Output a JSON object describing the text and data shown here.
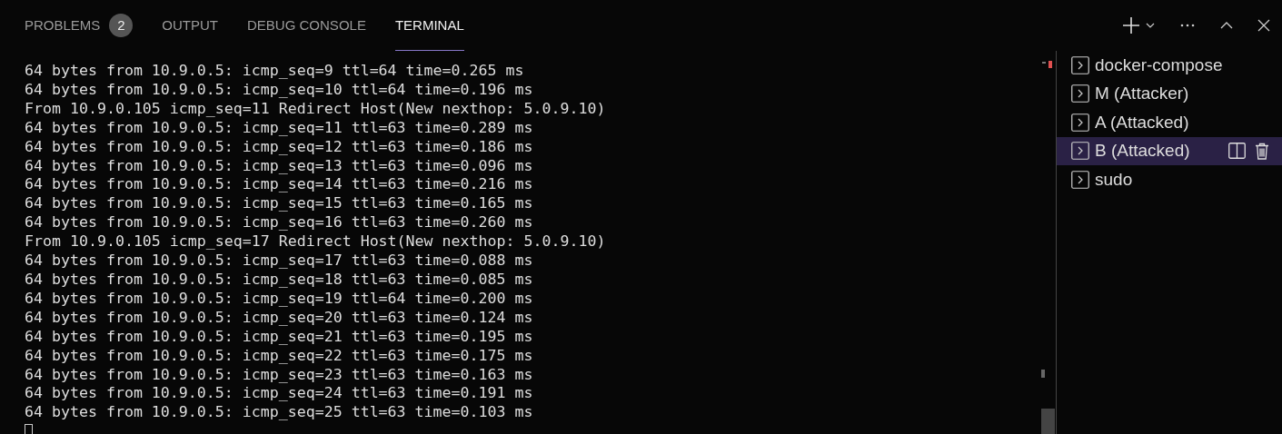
{
  "tabs": [
    {
      "label": "PROBLEMS",
      "selected": false,
      "badge": "2"
    },
    {
      "label": "OUTPUT",
      "selected": false
    },
    {
      "label": "DEBUG CONSOLE",
      "selected": false
    },
    {
      "label": "TERMINAL",
      "selected": true
    }
  ],
  "terminal": {
    "lines": [
      "64 bytes from 10.9.0.5: icmp_seq=9 ttl=64 time=0.265 ms",
      "64 bytes from 10.9.0.5: icmp_seq=10 ttl=64 time=0.196 ms",
      "From 10.9.0.105 icmp_seq=11 Redirect Host(New nexthop: 5.0.9.10)",
      "64 bytes from 10.9.0.5: icmp_seq=11 ttl=63 time=0.289 ms",
      "64 bytes from 10.9.0.5: icmp_seq=12 ttl=63 time=0.186 ms",
      "64 bytes from 10.9.0.5: icmp_seq=13 ttl=63 time=0.096 ms",
      "64 bytes from 10.9.0.5: icmp_seq=14 ttl=63 time=0.216 ms",
      "64 bytes from 10.9.0.5: icmp_seq=15 ttl=63 time=0.165 ms",
      "64 bytes from 10.9.0.5: icmp_seq=16 ttl=63 time=0.260 ms",
      "From 10.9.0.105 icmp_seq=17 Redirect Host(New nexthop: 5.0.9.10)",
      "64 bytes from 10.9.0.5: icmp_seq=17 ttl=63 time=0.088 ms",
      "64 bytes from 10.9.0.5: icmp_seq=18 ttl=63 time=0.085 ms",
      "64 bytes from 10.9.0.5: icmp_seq=19 ttl=64 time=0.200 ms",
      "64 bytes from 10.9.0.5: icmp_seq=20 ttl=63 time=0.124 ms",
      "64 bytes from 10.9.0.5: icmp_seq=21 ttl=63 time=0.195 ms",
      "64 bytes from 10.9.0.5: icmp_seq=22 ttl=63 time=0.175 ms",
      "64 bytes from 10.9.0.5: icmp_seq=23 ttl=63 time=0.163 ms",
      "64 bytes from 10.9.0.5: icmp_seq=24 ttl=63 time=0.191 ms",
      "64 bytes from 10.9.0.5: icmp_seq=25 ttl=63 time=0.103 ms"
    ]
  },
  "terminals": [
    {
      "label": "docker-compose",
      "selected": false
    },
    {
      "label": "M (Attacker)",
      "selected": false
    },
    {
      "label": "A (Attacked)",
      "selected": false
    },
    {
      "label": "B (Attacked)",
      "selected": true
    },
    {
      "label": "sudo",
      "selected": false
    }
  ]
}
